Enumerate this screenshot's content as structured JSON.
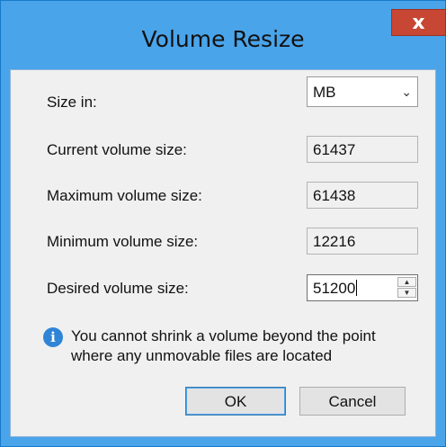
{
  "window": {
    "title": "Volume Resize",
    "close_glyph": "x"
  },
  "form": {
    "size_in_label": "Size in:",
    "size_in_value": "MB",
    "current_label": "Current volume size:",
    "current_value": "61437",
    "maximum_label": "Maximum volume size:",
    "maximum_value": "61438",
    "minimum_label": "Minimum volume size:",
    "minimum_value": "12216",
    "desired_label": "Desired volume size:",
    "desired_value": "51200"
  },
  "info": {
    "icon": "info-icon",
    "line1": "You cannot shrink a volume beyond the point",
    "line2": "where any unmovable files are located"
  },
  "buttons": {
    "ok_label": "OK",
    "cancel_label": "Cancel"
  },
  "colors": {
    "title_bar": "#4aa4ea",
    "close_button": "#c74634",
    "dialog_body": "#f0f0f0"
  }
}
